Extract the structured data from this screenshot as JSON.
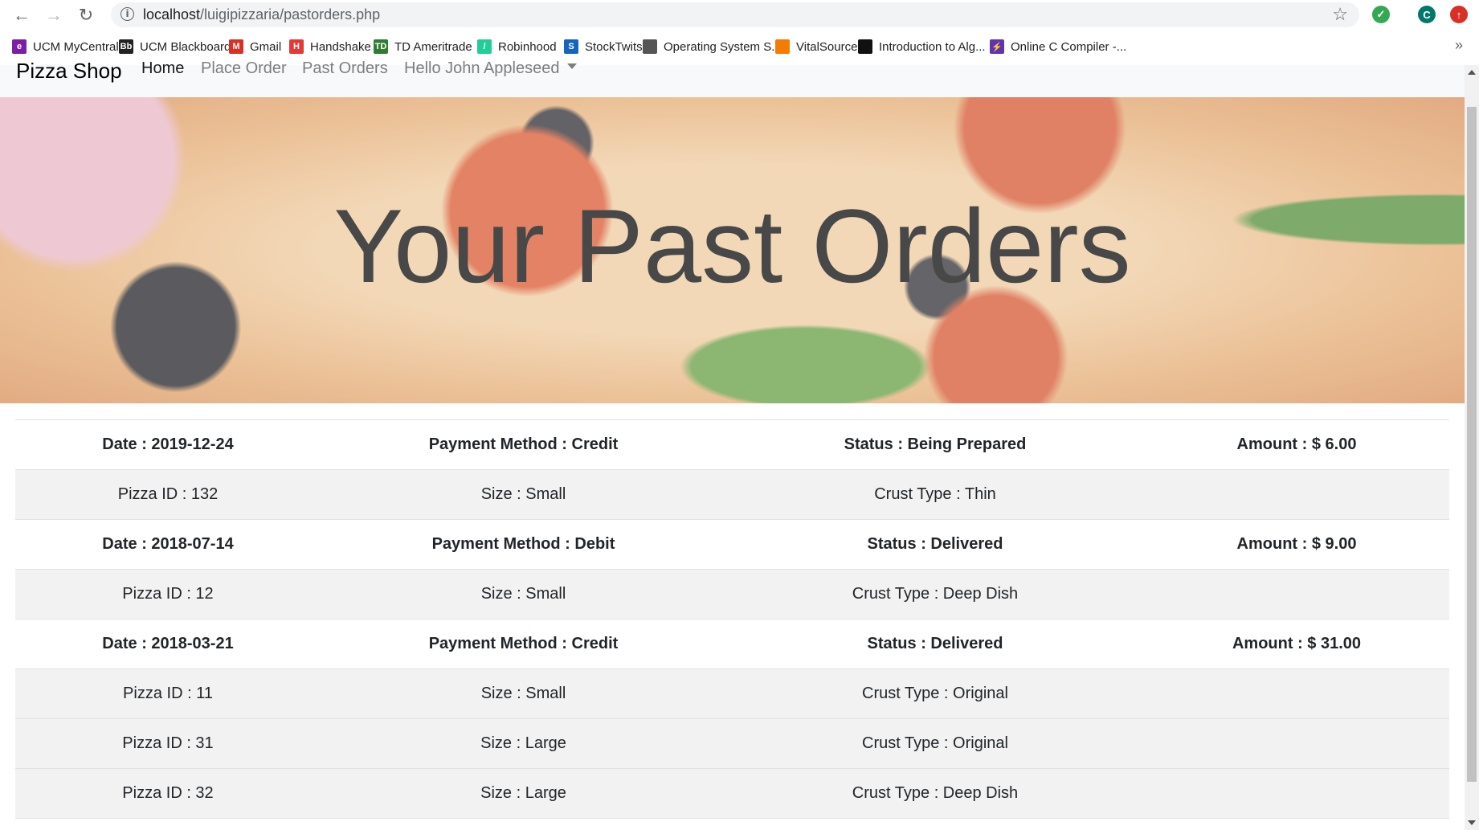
{
  "browser": {
    "url_host": "localhost",
    "url_path": "/luigipizzaria/pastorders.php",
    "profile_initial": "C",
    "bookmarks": [
      {
        "label": "UCM MyCentral",
        "icon": "mycentral-icon",
        "color": "#7b1fa2"
      },
      {
        "label": "UCM Blackboard",
        "icon": "blackboard-icon",
        "color": "#222222"
      },
      {
        "label": "Gmail",
        "icon": "gmail-icon",
        "color": "#d93025"
      },
      {
        "label": "Handshake",
        "icon": "handshake-icon",
        "color": "#e53935"
      },
      {
        "label": "TD Ameritrade",
        "icon": "td-ameritrade-icon",
        "color": "#2e7d32"
      },
      {
        "label": "Robinhood",
        "icon": "robinhood-icon",
        "color": "#21ce99"
      },
      {
        "label": "StockTwits",
        "icon": "stocktwits-icon",
        "color": "#1565c0"
      },
      {
        "label": "Operating System S...",
        "icon": "globe-icon",
        "color": "#555555"
      },
      {
        "label": "VitalSource",
        "icon": "vitalsource-icon",
        "color": "#f57c00"
      },
      {
        "label": "Introduction to Alg...",
        "icon": "barcode-icon",
        "color": "#111111"
      },
      {
        "label": "Online C Compiler -...",
        "icon": "compiler-icon",
        "color": "#5e35b1"
      }
    ]
  },
  "navbar": {
    "brand": "Pizza Shop",
    "links": [
      "Home",
      "Place Order",
      "Past Orders"
    ],
    "user_menu": "Hello John Appleseed"
  },
  "hero": {
    "title": "Your Past Orders"
  },
  "orders": [
    {
      "date": "Date : 2019-12-24",
      "payment": "Payment Method : Credit",
      "status": "Status : Being Prepared",
      "amount": "Amount : $ 6.00",
      "items": [
        {
          "pizza_id": "Pizza ID : 132",
          "size": "Size : Small",
          "crust": "Crust Type : Thin"
        }
      ]
    },
    {
      "date": "Date : 2018-07-14",
      "payment": "Payment Method : Debit",
      "status": "Status : Delivered",
      "amount": "Amount : $ 9.00",
      "items": [
        {
          "pizza_id": "Pizza ID : 12",
          "size": "Size : Small",
          "crust": "Crust Type : Deep Dish"
        }
      ]
    },
    {
      "date": "Date : 2018-03-21",
      "payment": "Payment Method : Credit",
      "status": "Status : Delivered",
      "amount": "Amount : $ 31.00",
      "items": [
        {
          "pizza_id": "Pizza ID : 11",
          "size": "Size : Small",
          "crust": "Crust Type : Original"
        },
        {
          "pizza_id": "Pizza ID : 31",
          "size": "Size : Large",
          "crust": "Crust Type : Original"
        },
        {
          "pizza_id": "Pizza ID : 32",
          "size": "Size : Large",
          "crust": "Crust Type : Deep Dish"
        }
      ]
    }
  ]
}
